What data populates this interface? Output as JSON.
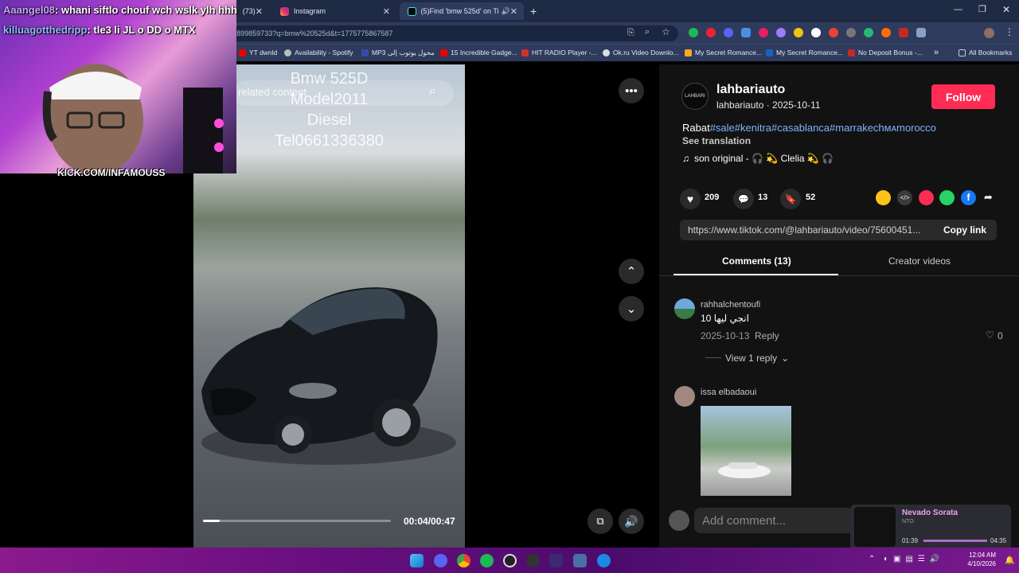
{
  "browser": {
    "tabs": [
      {
        "label": "(73)",
        "active": false
      },
      {
        "label": "Instagram",
        "active": false
      },
      {
        "label": "(5)Find 'bmw 525d' on TikTok",
        "active": true
      }
    ],
    "url": "tiktok.com/@lahbariauto/video/7560045140899859733?q=bmw%20525d&t=1775775867587",
    "bookmarks": [
      "YT dwnld",
      "Availability - Spotify",
      "MP3 محول يوتوب إلى",
      "15 Incredible Gadge...",
      "HIT RADIO Player -...",
      "Ok.ru Video Downlo...",
      "My Secret Romance...",
      "My Secret Romance...",
      "No Deposit Bonus -...",
      "All Bookmarks"
    ]
  },
  "stream": {
    "chat": [
      {
        "user": "Aaangel08",
        "text": ": whani siftlo chouf wch wslk ylh hhh"
      },
      {
        "user": "killuagotthedripp",
        "text": ": tle3 li JL o DD o MTX"
      }
    ],
    "kick_label": "KICK.COM/INFAMOUSS"
  },
  "video": {
    "overlay_lines": [
      "Bmw 525D",
      "Model2011",
      "Diesel",
      "Tel0661336380"
    ],
    "search_placeholder": "related content",
    "time": "00:04/00:47",
    "progress": 0.09
  },
  "post": {
    "author": "lahbariauto",
    "author_line": "lahbariauto · 2025-10-11",
    "follow_label": "Follow",
    "caption_prefix": "Rabat",
    "caption_tags": "#sale#kenitra#casablanca#marrakech",
    "caption_suffix": "ᴍᴀmorocco",
    "see_translation": "See translation",
    "music": "son original - 🎧 💫 Clelia 💫 🎧",
    "likes": "209",
    "comments": "13",
    "saves": "52",
    "link": "https://www.tiktok.com/@lahbariauto/video/75600451...",
    "copy_link": "Copy link",
    "tab_comments": "Comments (13)",
    "tab_creator": "Creator videos"
  },
  "comments": [
    {
      "user": "rahhalchentoufi",
      "text": "10 انجي ليها",
      "date": "2025-10-13",
      "reply": "Reply",
      "likes": "0",
      "view_replies": "View 1 reply"
    },
    {
      "user": "issa elbadaoui"
    }
  ],
  "add_comment_placeholder": "Add comment...",
  "music_player": {
    "title": "Nevado Sorata",
    "artist": "NTO",
    "elapsed": "01:39",
    "total": "04:35"
  },
  "clock": {
    "time": "12:04 AM",
    "date": "4/10/2026"
  },
  "colors": {
    "follow": "#fe2c55",
    "hashtag": "#7fb4ff"
  }
}
